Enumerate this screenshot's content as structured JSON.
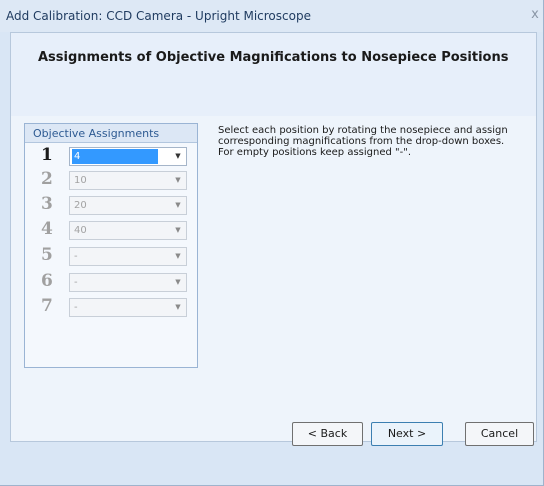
{
  "window": {
    "title": "Add Calibration: CCD Camera - Upright Microscope",
    "close_glyph": "x"
  },
  "header": {
    "title": "Assignments of Objective Magnifications to Nosepiece Positions"
  },
  "objective_assignments": {
    "title": "Objective Assignments",
    "rows": [
      {
        "position": "1",
        "value": "4",
        "enabled": true
      },
      {
        "position": "2",
        "value": "10",
        "enabled": false
      },
      {
        "position": "3",
        "value": "20",
        "enabled": false
      },
      {
        "position": "4",
        "value": "40",
        "enabled": false
      },
      {
        "position": "5",
        "value": "-",
        "enabled": false
      },
      {
        "position": "6",
        "value": "-",
        "enabled": false
      },
      {
        "position": "7",
        "value": "-",
        "enabled": false
      }
    ]
  },
  "instructions": {
    "line1": "Select each position by rotating the nosepiece and assign",
    "line2": "corresponding magnifications from the drop-down boxes.",
    "line3": "For empty positions keep assigned \"-\"."
  },
  "footer": {
    "back_label": "< Back",
    "next_label": "Next >",
    "cancel_label": "Cancel"
  }
}
